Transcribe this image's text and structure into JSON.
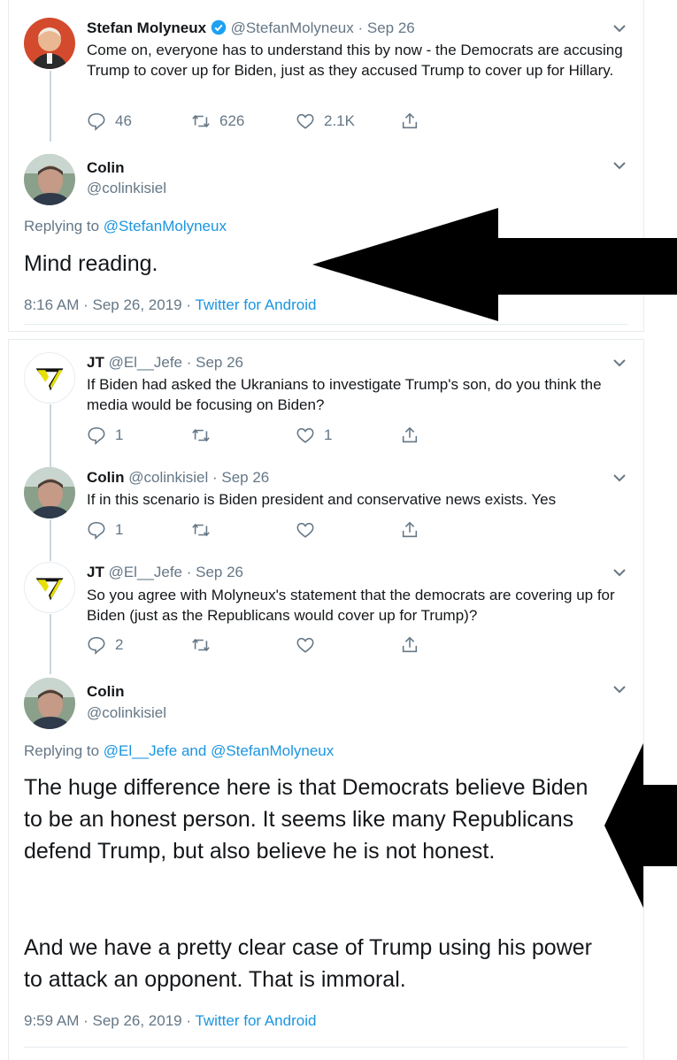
{
  "panel1": {
    "parent": {
      "name": "Stefan Molyneux",
      "handle": "@StefanMolyneux",
      "date": "· Sep 26",
      "text": "Come on, everyone has to understand this by now - the Democrats are accusing Trump to cover up for Biden, just as they accused Trump to cover up for Hillary.",
      "replies": "46",
      "retweets": "626",
      "likes": "2.1K"
    },
    "focus": {
      "name": "Colin",
      "handle": "@colinkisiel",
      "replying_prefix": "Replying to",
      "replying_to": "@StefanMolyneux",
      "text": "Mind reading.",
      "time": "8:16 AM · Sep 26, 2019 ·",
      "source": "Twitter for Android"
    }
  },
  "panel2": {
    "tweet1": {
      "name": "JT",
      "handle": "@El__Jefe",
      "date": "· Sep 26",
      "text": "If Biden had asked the Ukranians to investigate Trump's son, do you think the media would be focusing on Biden?",
      "replies": "1",
      "retweets": "",
      "likes": "1"
    },
    "tweet2": {
      "name": "Colin",
      "handle": "@colinkisiel",
      "date": "· Sep 26",
      "text": "If in this scenario is Biden president and conservative news exists.  Yes",
      "replies": "1",
      "retweets": "",
      "likes": ""
    },
    "tweet3": {
      "name": "JT",
      "handle": "@El__Jefe",
      "date": "· Sep 26",
      "text": "So you agree with Molyneux's statement that the democrats are covering up for Biden (just as the Republicans would cover up for Trump)?",
      "replies": "2",
      "retweets": "",
      "likes": ""
    },
    "focus": {
      "name": "Colin",
      "handle": "@colinkisiel",
      "replying_prefix": "Replying to",
      "replying_to_1": "@El__Jefe",
      "replying_and": "and",
      "replying_to_2": "@StefanMolyneux",
      "paragraph1": "The huge difference here is that Democrats believe Biden to be an honest person.  It seems like many Republicans defend Trump, but also believe he is not honest.",
      "paragraph2": "And we have a pretty clear case of Trump using his power to attack an opponent.  That is immoral.",
      "time": "9:59 AM · Sep 26, 2019 ·",
      "source": "Twitter for Android"
    }
  },
  "colors": {
    "link": "#1b95e0",
    "muted": "#657786",
    "text": "#14171a",
    "verified": "#1da1f2"
  },
  "icons": [
    "verified-badge-icon",
    "reply-icon",
    "retweet-icon",
    "like-icon",
    "share-icon",
    "chevron-down-icon",
    "arrow-left-icon"
  ]
}
